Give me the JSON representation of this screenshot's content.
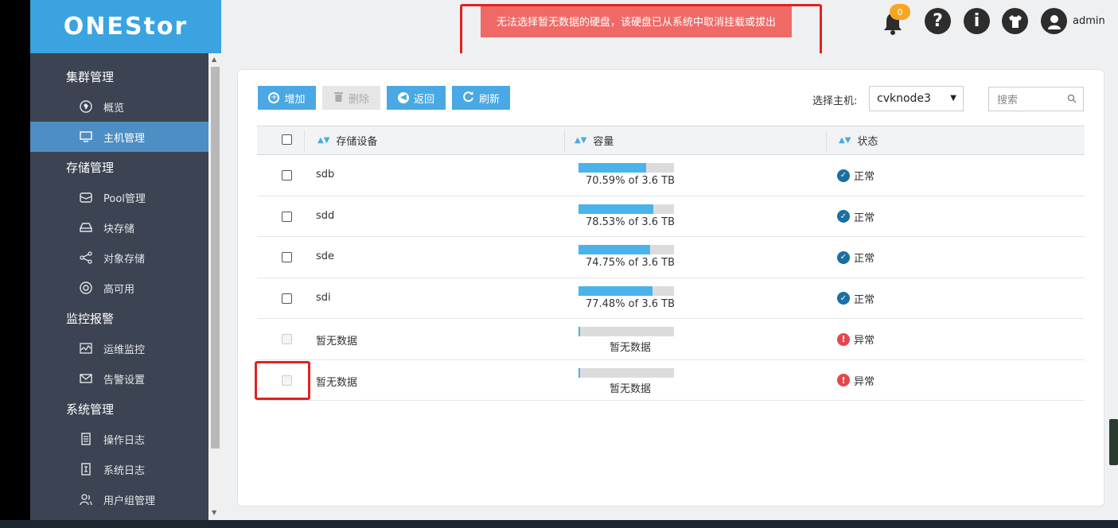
{
  "app": {
    "logo": "ONEStor"
  },
  "alert": {
    "message": "无法选择暂无数据的硬盘，该硬盘已从系统中取消挂载或拔出"
  },
  "header": {
    "notification_count": "0",
    "user": "admin"
  },
  "sidebar": {
    "groups": [
      {
        "title": "集群管理",
        "items": [
          {
            "label": "概览",
            "icon": "globe-icon"
          },
          {
            "label": "主机管理",
            "icon": "monitor-icon",
            "active": true
          }
        ]
      },
      {
        "title": "存储管理",
        "items": [
          {
            "label": "Pool管理",
            "icon": "box-icon"
          },
          {
            "label": "块存储",
            "icon": "drive-icon"
          },
          {
            "label": "对象存储",
            "icon": "share-icon"
          },
          {
            "label": "高可用",
            "icon": "lifebuoy-icon"
          }
        ]
      },
      {
        "title": "监控报警",
        "items": [
          {
            "label": "运维监控",
            "icon": "pulse-icon"
          },
          {
            "label": "告警设置",
            "icon": "mail-icon"
          }
        ]
      },
      {
        "title": "系统管理",
        "items": [
          {
            "label": "操作日志",
            "icon": "doc-icon"
          },
          {
            "label": "系统日志",
            "icon": "log-icon"
          },
          {
            "label": "用户组管理",
            "icon": "users-icon"
          }
        ]
      }
    ]
  },
  "toolbar": {
    "add": "增加",
    "delete": "删除",
    "back": "返回",
    "refresh": "刷新"
  },
  "host": {
    "label": "选择主机:",
    "selected": "cvknode3"
  },
  "search": {
    "placeholder": "搜索"
  },
  "table": {
    "headers": {
      "device": "存储设备",
      "capacity": "容量",
      "status": "状态"
    },
    "rows": [
      {
        "device": "sdb",
        "usage": 70.59,
        "capacity": "70.59% of 3.6 TB",
        "status": "正常",
        "ok": true
      },
      {
        "device": "sdd",
        "usage": 78.53,
        "capacity": "78.53% of 3.6 TB",
        "status": "正常",
        "ok": true
      },
      {
        "device": "sde",
        "usage": 74.75,
        "capacity": "74.75% of 3.6 TB",
        "status": "正常",
        "ok": true
      },
      {
        "device": "sdi",
        "usage": 77.48,
        "capacity": "77.48% of 3.6 TB",
        "status": "正常",
        "ok": true
      },
      {
        "device": "暂无数据",
        "usage": 1,
        "capacity": "暂无数据",
        "status": "异常",
        "ok": false
      },
      {
        "device": "暂无数据",
        "usage": 1,
        "capacity": "暂无数据",
        "status": "异常",
        "ok": false
      }
    ]
  },
  "colors": {
    "accent": "#4aa9e4",
    "sidebar": "#3c4352",
    "alert": "#ef6a66",
    "ok": "#1a6fa3",
    "error": "#e3484b"
  }
}
